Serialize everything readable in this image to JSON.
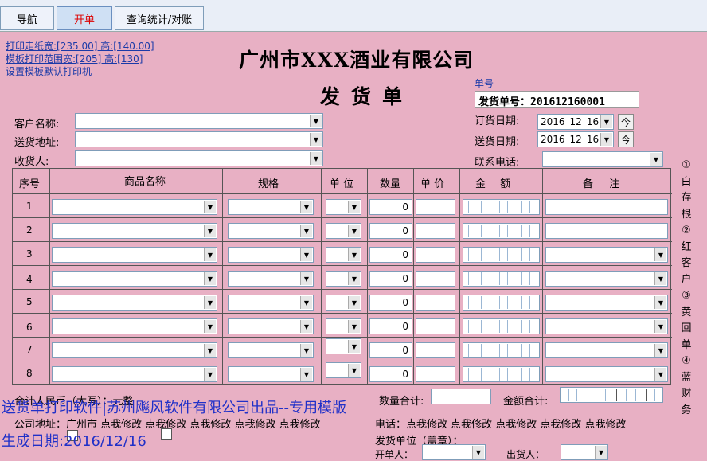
{
  "tabs": [
    {
      "label": "导航"
    },
    {
      "label": "开单"
    },
    {
      "label": "查询统计/对账"
    }
  ],
  "links": {
    "print_paper": "打印走纸宽:[235.00] 高:[140.00]",
    "template_range": "模板打印范围宽:[205] 高:[130]",
    "default_printer": "设置模板默认打印机"
  },
  "header": {
    "company": "广州市XXX酒业有限公司",
    "doc_title": "发货单",
    "order_no_label": "单号",
    "order_no": "发货单号：201612160001"
  },
  "form": {
    "customer_label": "客户名称:",
    "address_label": "送货地址:",
    "receiver_label": "收货人:",
    "order_date_label": "订货日期:",
    "delivery_date_label": "送货日期:",
    "phone_label": "联系电话:",
    "order_date": {
      "year": "2016",
      "month": "12",
      "day": "16"
    },
    "delivery_date": {
      "year": "2016",
      "month": "12",
      "day": "16"
    },
    "today_glyph": "今"
  },
  "table": {
    "headers": {
      "seq": "序号",
      "name": "商品名称",
      "spec": "规格",
      "unit": "单 位",
      "qty": "数量",
      "price": "单 价",
      "amount": "金 额",
      "remark": "备 注"
    },
    "rows": [
      {
        "no": "1",
        "qty": "0"
      },
      {
        "no": "2",
        "qty": "0"
      },
      {
        "no": "3",
        "qty": "0"
      },
      {
        "no": "4",
        "qty": "0"
      },
      {
        "no": "5",
        "qty": "0"
      },
      {
        "no": "6",
        "qty": "0"
      },
      {
        "no": "7",
        "qty": "0"
      },
      {
        "no": "8",
        "qty": "0"
      }
    ]
  },
  "copies": [
    "①",
    "白",
    "存",
    "根",
    "②",
    "红",
    "客",
    "户",
    "③",
    "黄",
    "回",
    "单",
    "④",
    "蓝",
    "财",
    "务"
  ],
  "footer": {
    "total_rmb_label": "合计人民币（大写）：",
    "total_rmb_value": "元整",
    "qty_total_label": "数量合计:",
    "amount_total_label": "金额合计:",
    "company_address": "公司地址：广州市 点我修改 点我修改 点我修改 点我修改 点我修改",
    "phone_line": "电话：点我修改 点我修改 点我修改 点我修改 点我修改",
    "unit_label": "发货单位（盖章）：",
    "footer_partial": "开单人：",
    "shipper_partial": "出货人："
  },
  "overlay": {
    "line1": "送货单打印软件|苏州飚风软件有限公司出品--专用模版",
    "line2": "生成日期:2016/12/16"
  }
}
